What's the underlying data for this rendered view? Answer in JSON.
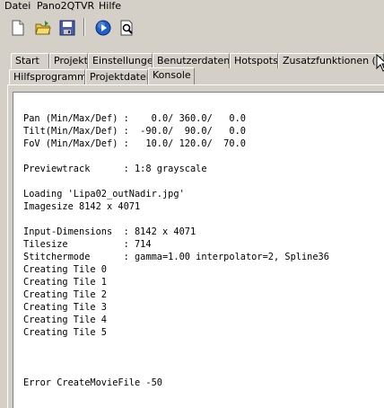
{
  "menubar": {
    "items": [
      "Datei",
      "Pano2QTVR",
      "Hilfe"
    ]
  },
  "toolbar": {
    "buttons": [
      {
        "name": "new-document-icon"
      },
      {
        "name": "open-folder-icon"
      },
      {
        "name": "save-disk-icon"
      },
      {
        "name": "play-icon"
      },
      {
        "name": "preview-magnifier-icon"
      }
    ]
  },
  "tabs": {
    "row1": [
      "Start",
      "Projekt",
      "Einstellungen",
      "Benutzerdaten",
      "Hotspots",
      "Zusatzfunktionen (Spr"
    ],
    "row2": [
      "Hilfsprogramme",
      "Projektdatei",
      "Konsole"
    ],
    "active": "Konsole"
  },
  "console": {
    "lines": [
      "Pan (Min/Max/Def) :    0.0/ 360.0/   0.0",
      "Tilt(Min/Max/Def) :  -90.0/  90.0/   0.0",
      "FoV (Min/Max/Def) :   10.0/ 120.0/  70.0",
      "",
      "Previewtrack      : 1:8 grayscale",
      "",
      "Loading 'Lipa02_outNadir.jpg'",
      "Imagesize 8142 x 4071",
      "",
      "Input-Dimensions  : 8142 x 4071",
      "Tilesize          : 714",
      "Stitchermode      : gamma=1.00 interpolator=2, Spline36",
      "Creating Tile 0",
      "Creating Tile 1",
      "Creating Tile 2",
      "Creating Tile 3",
      "Creating Tile 4",
      "Creating Tile 5",
      "",
      "",
      "",
      "Error CreateMovieFile -50"
    ]
  },
  "colors": {
    "window_bg": "#d4d0c8",
    "console_bg": "#ffffff",
    "play_button": "#1e5fc8"
  }
}
